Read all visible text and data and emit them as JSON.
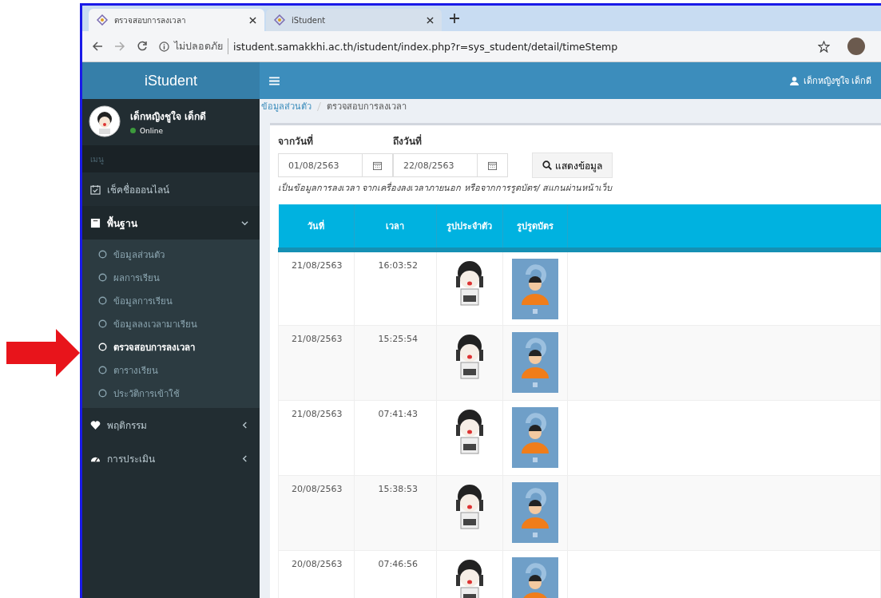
{
  "browser": {
    "tabs": [
      {
        "title": "ตรวจสอบการลงเวลา",
        "selected": true
      },
      {
        "title": "iStudent",
        "selected": false
      }
    ],
    "address": {
      "security": "ไม่ปลอดภัย",
      "url": "istudent.samakkhi.ac.th/istudent/index.php?r=sys_student/detail/timeStemp"
    }
  },
  "app": {
    "logo": "iStudent",
    "user_name": "เด็กหญิงชูใจ เด็กดี"
  },
  "sidebar": {
    "user": {
      "name": "เด็กหญิงชูใจ เด็กดี",
      "status": "Online"
    },
    "header": "เมนู",
    "items": [
      {
        "label": "เช็คชื่อออนไลน์",
        "kind": "link"
      },
      {
        "label": "พื้นฐาน",
        "kind": "group",
        "expanded": true,
        "children": [
          {
            "label": "ข้อมูลส่วนตัว",
            "selected": false
          },
          {
            "label": "ผลการเรียน",
            "selected": false
          },
          {
            "label": "ข้อมูลการเรียน",
            "selected": false
          },
          {
            "label": "ข้อมูลลงเวลามาเรียน",
            "selected": false
          },
          {
            "label": "ตรวจสอบการลงเวลา",
            "selected": true
          },
          {
            "label": "ตารางเรียน",
            "selected": false
          },
          {
            "label": "ประวัติการเข้าใช้",
            "selected": false
          }
        ]
      },
      {
        "label": "พฤติกรรม",
        "kind": "group",
        "expanded": false
      },
      {
        "label": "การประเมิน",
        "kind": "group",
        "expanded": false
      }
    ]
  },
  "breadcrumb": [
    "ข้อมูลส่วนตัว",
    "ตรวจสอบการลงเวลา"
  ],
  "filter": {
    "from_label": "จากวันที่",
    "from_value": "01/08/2563",
    "to_label": "ถึงวันที่",
    "to_value": "22/08/2563",
    "button": "แสดงข้อมูล",
    "note": "เป็นข้อมูลการลงเวลา จากเครื่องลงเวลาภายนอก หรือจากการรูดบัตร/ สแกนผ่านหน้าเว็บ"
  },
  "table": {
    "columns": [
      "วันที่",
      "เวลา",
      "รูปประจำตัว",
      "รูปรูดบัตร"
    ],
    "rows": [
      {
        "date": "21/08/2563",
        "time": "16:03:52"
      },
      {
        "date": "21/08/2563",
        "time": "15:25:54"
      },
      {
        "date": "21/08/2563",
        "time": "07:41:43"
      },
      {
        "date": "20/08/2563",
        "time": "15:38:53"
      },
      {
        "date": "20/08/2563",
        "time": "07:46:56"
      }
    ]
  }
}
